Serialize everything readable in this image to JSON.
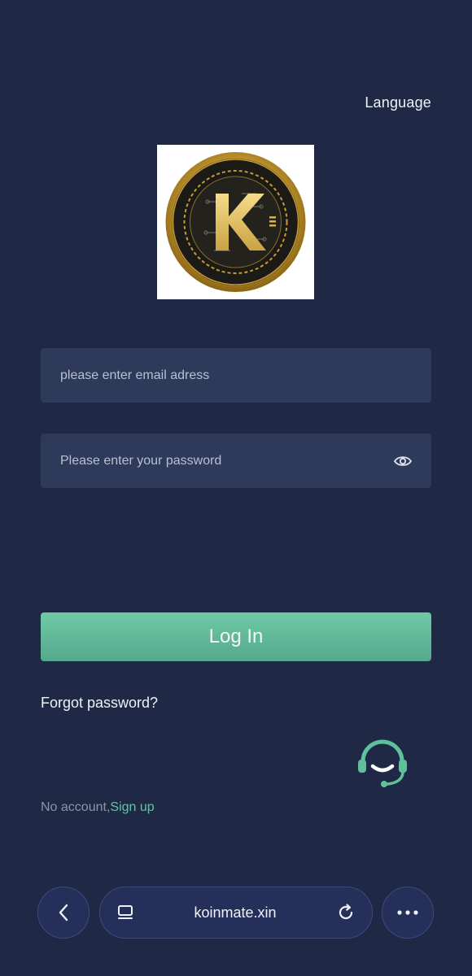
{
  "header": {
    "language_label": "Language"
  },
  "logo": {
    "letter": "K"
  },
  "form": {
    "email_placeholder": "please enter email adress",
    "email_value": "",
    "password_placeholder": "Please enter your password",
    "password_value": "",
    "login_label": "Log In",
    "forgot_label": "Forgot password?",
    "no_account_label": "No account,",
    "signup_label": "Sign up"
  },
  "support": {
    "icon": "headset-icon"
  },
  "browser": {
    "url": "koinmate.xin"
  },
  "colors": {
    "background": "#1f2946",
    "input_bg": "#2d3a5a",
    "accent": "#62c4a0",
    "gold": "#c9a227"
  }
}
